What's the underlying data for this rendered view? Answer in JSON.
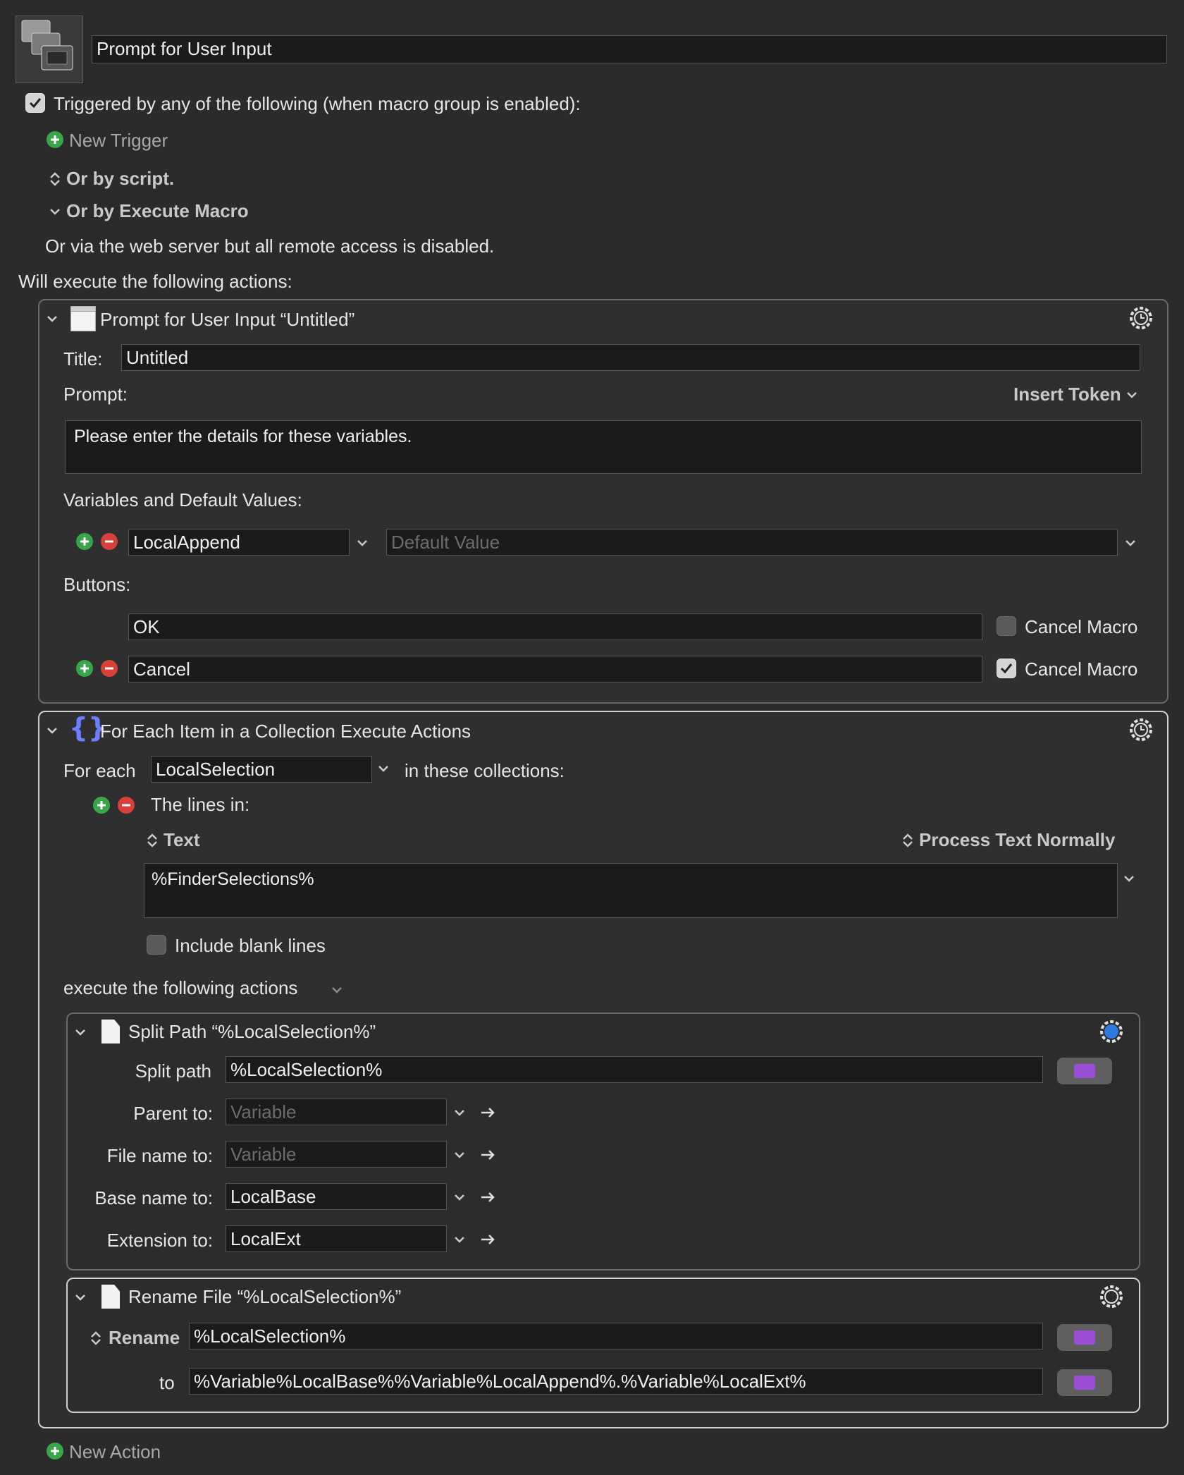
{
  "macro": {
    "name": "Prompt for User Input",
    "trigger_checkbox_label": "Triggered by any of the following (when macro group is enabled):",
    "new_trigger": "New Trigger",
    "or_by_script": "Or by script.",
    "or_by_execute": "Or by Execute Macro",
    "web_server_note": "Or via the web server but all remote access is disabled.",
    "will_execute": "Will execute the following actions:",
    "new_action": "New Action"
  },
  "prompt_action": {
    "header": "Prompt for User Input “Untitled”",
    "title_label": "Title:",
    "title_value": "Untitled",
    "prompt_label": "Prompt:",
    "insert_token": "Insert Token",
    "prompt_value": "Please enter the details for these variables.",
    "vars_label": "Variables and Default Values:",
    "variable_name": "LocalAppend",
    "default_placeholder": "Default Value",
    "buttons_label": "Buttons:",
    "buttons": [
      {
        "label": "OK",
        "cancel_label": "Cancel Macro",
        "cancel_checked": false
      },
      {
        "label": "Cancel",
        "cancel_label": "Cancel Macro",
        "cancel_checked": true
      }
    ]
  },
  "foreach_action": {
    "header": "For Each Item in a Collection Execute Actions",
    "for_each_label": "For each",
    "variable": "LocalSelection",
    "in_collections": "in these collections:",
    "lines_in": "The lines in:",
    "text_mode": "Text",
    "process_mode": "Process Text Normally",
    "text_value": "%FinderSelections%",
    "include_blank": "Include blank lines",
    "execute_following": "execute the following actions"
  },
  "split_action": {
    "header": "Split Path “%LocalSelection%”",
    "split_label": "Split path",
    "split_value": "%LocalSelection%",
    "rows": [
      {
        "label": "Parent to:",
        "value": "Variable",
        "placeholder": true
      },
      {
        "label": "File name to:",
        "value": "Variable",
        "placeholder": true
      },
      {
        "label": "Base name to:",
        "value": "LocalBase",
        "placeholder": false
      },
      {
        "label": "Extension to:",
        "value": "LocalExt",
        "placeholder": false
      }
    ]
  },
  "rename_action": {
    "header": "Rename File “%LocalSelection%”",
    "rename_label": "Rename",
    "rename_value": "%LocalSelection%",
    "to_label": "to",
    "to_value": "%Variable%LocalBase%%Variable%LocalAppend%.%Variable%LocalExt%"
  },
  "colors": {
    "background": "#2b2b2b",
    "field": "#1b1b1b",
    "add": "#3aa548",
    "remove": "#d8403a",
    "accent_blue": "#2f7ae0",
    "token_purple": "#9b4fd6"
  }
}
